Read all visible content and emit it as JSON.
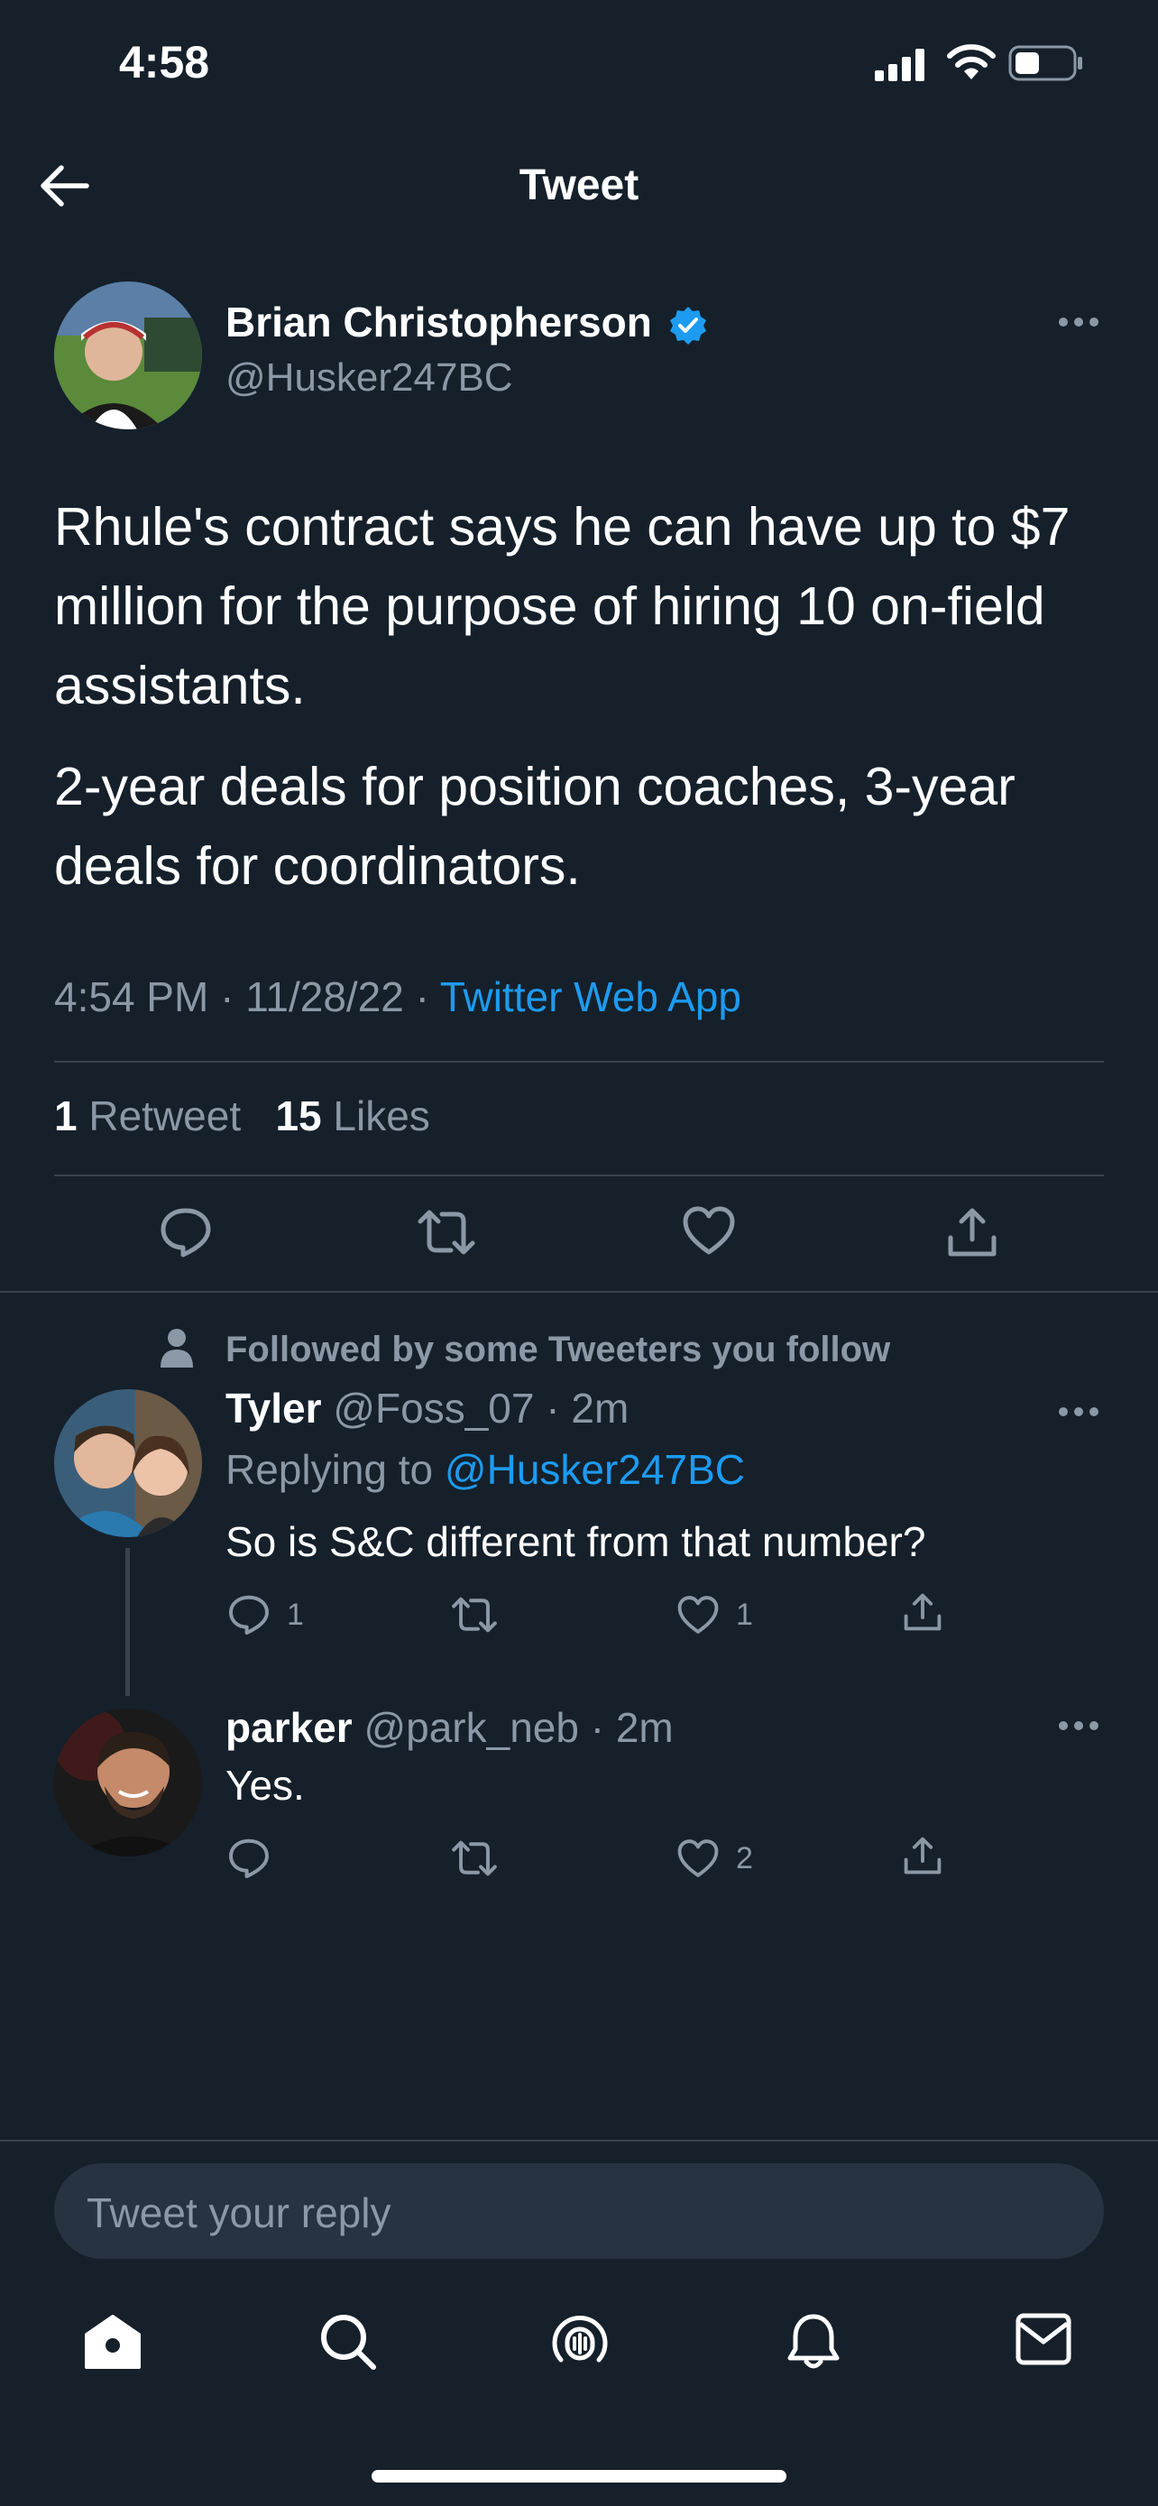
{
  "status_bar": {
    "time": "4:58"
  },
  "header": {
    "title": "Tweet"
  },
  "tweet": {
    "author_name": "Brian Christopherson",
    "author_handle": "@Husker247BC",
    "paragraphs": [
      "Rhule's contract says he can have up to $7 million for the purpose of hiring 10 on-field assistants.",
      "2-year deals for position coaches, 3-year deals for coordinators."
    ],
    "time": "4:54 PM",
    "date": "11/28/22",
    "separator": "·",
    "source": "Twitter Web App",
    "retweets_count": "1",
    "retweets_label": "Retweet",
    "likes_count": "15",
    "likes_label": "Likes"
  },
  "replies_header": {
    "followed_text": "Followed by some Tweeters you follow"
  },
  "replies": [
    {
      "name": "Tyler",
      "handle": "@Foss_07",
      "time": "2m",
      "replying_to_label": "Replying to",
      "replying_to_handle": "@Husker247BC",
      "text": "So is S&C different from that number?",
      "reply_count": "1",
      "like_count": "1"
    },
    {
      "name": "parker",
      "handle": "@park_neb",
      "time": "2m",
      "text": "Yes.",
      "like_count": "2"
    }
  ],
  "composer": {
    "placeholder": "Tweet your reply"
  },
  "colors": {
    "background": "#15202b",
    "accent": "#1d9bf0",
    "muted": "#8b98a5",
    "divider": "#38444d"
  },
  "tabs": [
    "home-icon",
    "search-icon",
    "spaces-icon",
    "notifications-icon",
    "messages-icon"
  ]
}
